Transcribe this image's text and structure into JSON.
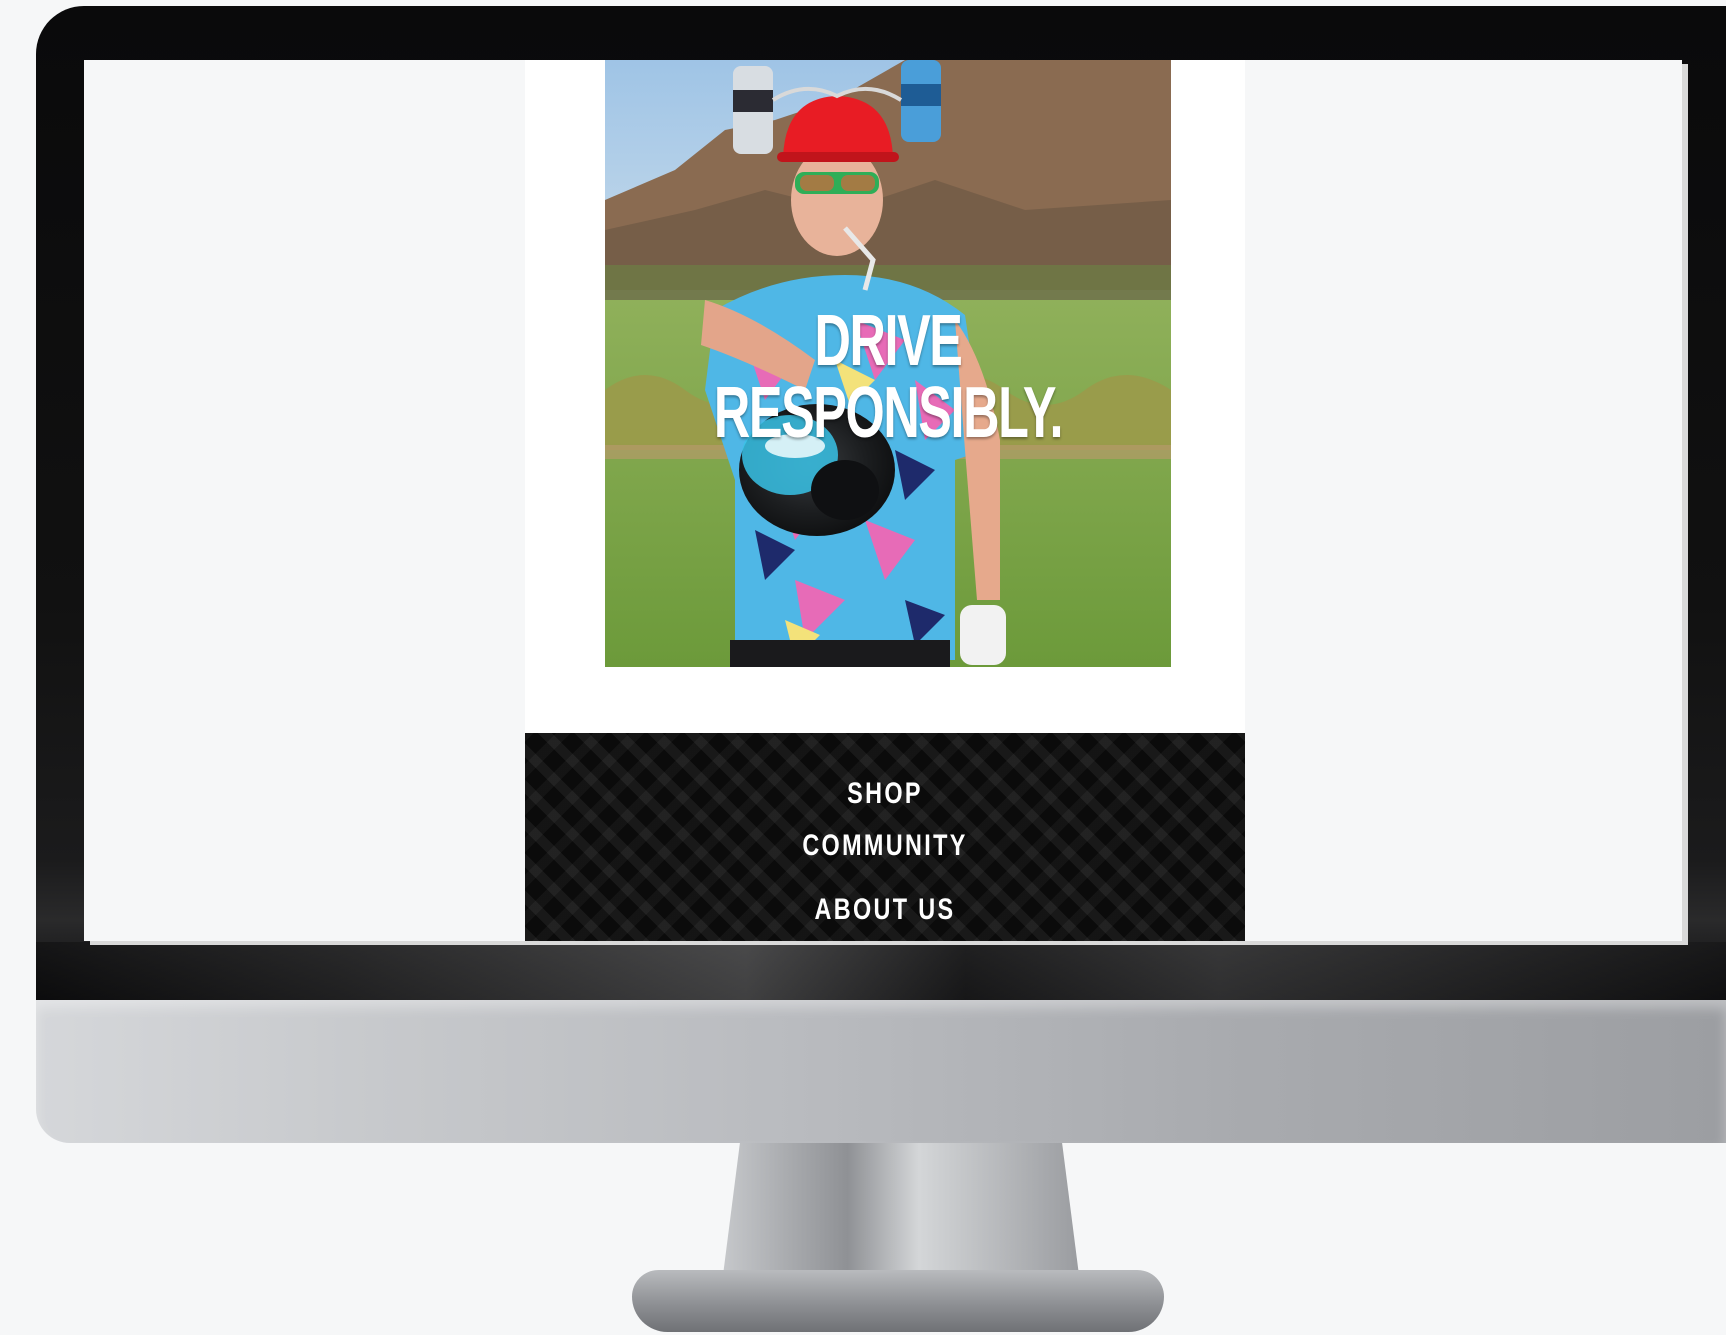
{
  "hero": {
    "headline": "DRIVE RESPONSIBLY.",
    "photo_subject": "golfer in hard hat with can holders swinging driver toward camera",
    "colors": {
      "sky": "#a9cbe8",
      "mountain": "#8a6c52",
      "grass": "#7ea545",
      "helmet": "#e81c24",
      "shirt_blue": "#4fb7e6",
      "shirt_pink": "#e76bb7"
    }
  },
  "footer_nav": {
    "items": [
      {
        "label": "SHOP"
      },
      {
        "label": "COMMUNITY"
      },
      {
        "label": "ABOUT US"
      }
    ],
    "background": "#0b0b0b",
    "text_color": "#ffffff"
  },
  "device": {
    "frame_color": "#0a0a0b",
    "chin_color": "#b9bbbf"
  }
}
